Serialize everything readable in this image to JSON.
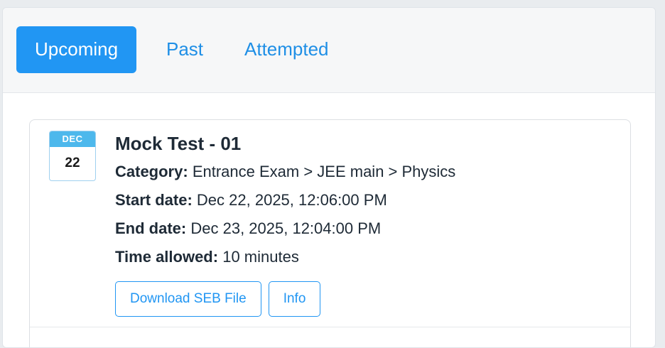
{
  "tabs": [
    {
      "label": "Upcoming",
      "active": true
    },
    {
      "label": "Past",
      "active": false
    },
    {
      "label": "Attempted",
      "active": false
    }
  ],
  "test": {
    "date_month": "DEC",
    "date_day": "22",
    "title": "Mock Test - 01",
    "category_label": "Category:",
    "category_value": "Entrance Exam > JEE main > Physics",
    "start_label": "Start date:",
    "start_value": "Dec 22, 2025, 12:06:00 PM",
    "end_label": "End date:",
    "end_value": "Dec 23, 2025, 12:04:00 PM",
    "time_label": "Time allowed:",
    "time_value": "10 minutes",
    "download_button": "Download SEB File",
    "info_button": "Info"
  },
  "colors": {
    "accent": "#2196f3",
    "badge_header": "#4db8ec",
    "text": "#1e2a36"
  }
}
